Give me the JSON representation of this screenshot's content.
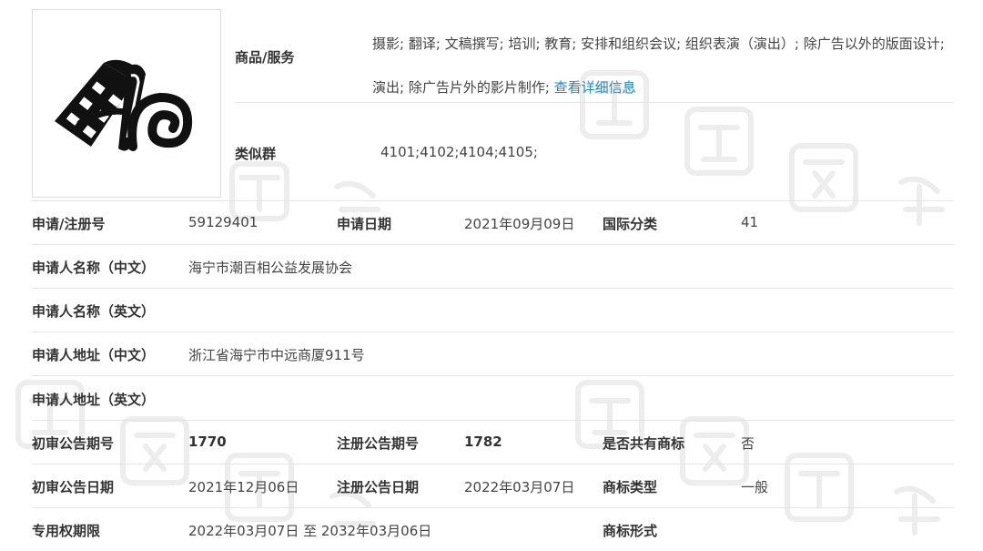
{
  "goods_services": {
    "label": "商品/服务",
    "text": "摄影; 翻译; 文稿撰写; 培训; 教育; 安排和组织会议; 组织表演（演出）; 除广告以外的版面设计; 演出; 除广告片外的影片制作;",
    "detail_link": "查看详细信息"
  },
  "similar_group": {
    "label": "类似群",
    "value": "4101;4102;4104;4105;"
  },
  "rows": {
    "reg_no": {
      "label": "申请/注册号",
      "value": "59129401"
    },
    "apply_date": {
      "label": "申请日期",
      "value": "2021年09月09日"
    },
    "intl_class": {
      "label": "国际分类",
      "value": "41"
    },
    "applicant_cn": {
      "label": "申请人名称（中文）",
      "value": "海宁市潮百相公益发展协会"
    },
    "applicant_en": {
      "label": "申请人名称（英文）",
      "value": ""
    },
    "address_cn": {
      "label": "申请人地址（中文）",
      "value": "浙江省海宁市中远商厦911号"
    },
    "address_en": {
      "label": "申请人地址（英文）",
      "value": ""
    },
    "prelim_issue": {
      "label": "初审公告期号",
      "value": "1770"
    },
    "reg_issue": {
      "label": "注册公告期号",
      "value": "1782"
    },
    "shared_mark": {
      "label": "是否共有商标",
      "value": "否"
    },
    "prelim_date": {
      "label": "初审公告日期",
      "value": "2021年12月06日"
    },
    "reg_date": {
      "label": "注册公告日期",
      "value": "2022年03月07日"
    },
    "mark_type": {
      "label": "商标类型",
      "value": "一般"
    },
    "exclusive_period": {
      "label": "专用权期限",
      "value": "2022年03月07日 至 2032年03月06日"
    },
    "mark_form": {
      "label": "商标形式",
      "value": ""
    }
  },
  "colors": {
    "link": "#1e88c8",
    "label": "#333333",
    "divider": "#e4e4e4",
    "watermark": "#ededed"
  }
}
